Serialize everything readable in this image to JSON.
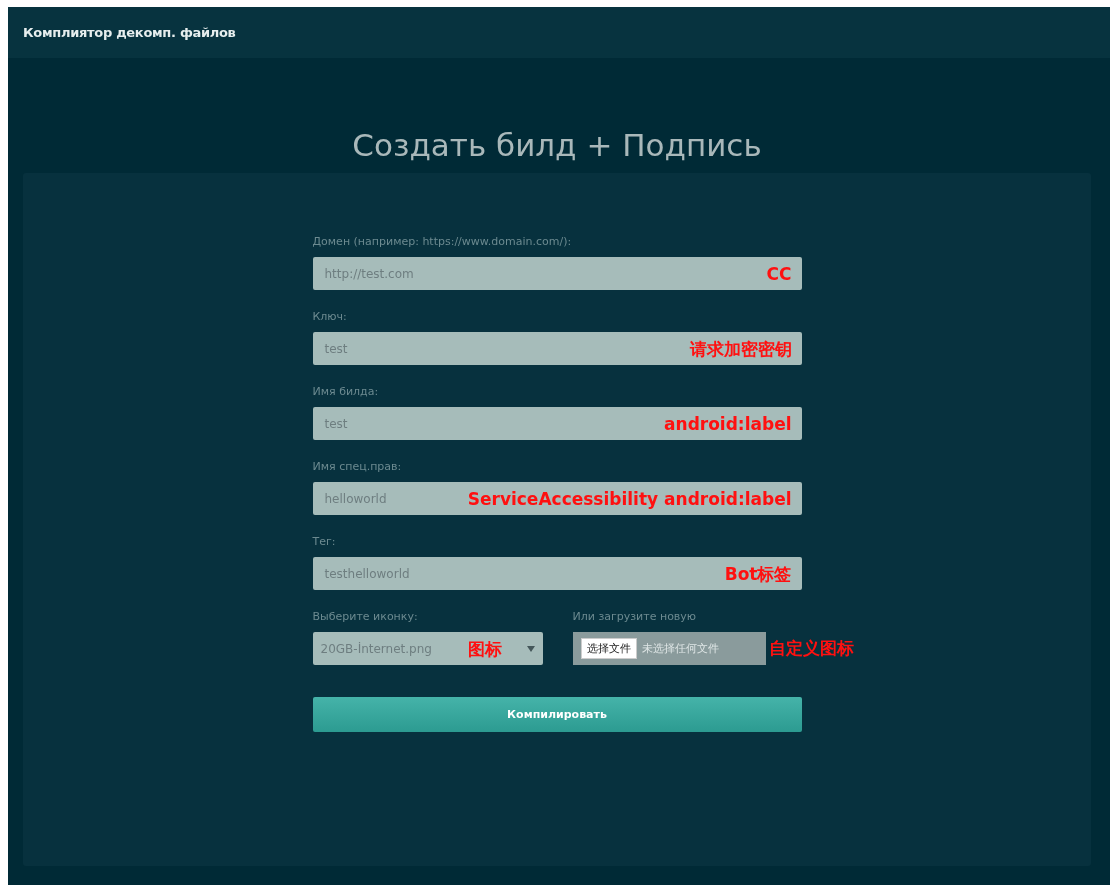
{
  "navbar": {
    "title": "Комплиятор декомп. файлов"
  },
  "heading": "Создать билд + Подпись",
  "fields": [
    {
      "label": "Домен (например: https://www.domain.com/):",
      "value": "http://test.com",
      "annotation": "CC"
    },
    {
      "label": "Ключ:",
      "value": "test",
      "annotation": "请求加密密钥"
    },
    {
      "label": "Имя билда:",
      "value": "test",
      "annotation": "android:label"
    },
    {
      "label": "Имя спец.прав:",
      "value": "helloworld",
      "annotation": "ServiceAccessibility android:label"
    },
    {
      "label": "Тег:",
      "value": "testhelloworld",
      "annotation": "Bot标签"
    }
  ],
  "icon_select": {
    "label": "Выберите иконку:",
    "value": "20GB-İnternet.png",
    "annotation": "图标"
  },
  "upload": {
    "label": "Или загрузите новую",
    "button": "选择文件",
    "status": "未选择任何文件",
    "annotation": "自定义图标"
  },
  "submit": "Компилировать"
}
